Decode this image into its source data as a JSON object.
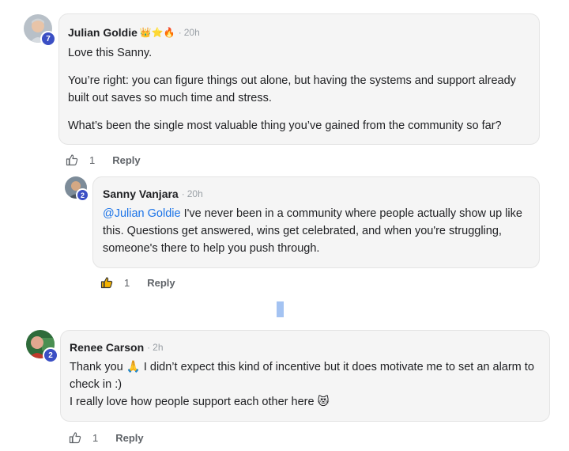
{
  "comments": [
    {
      "author": "Julian Goldie",
      "badges": "👑⭐🔥",
      "time": "20h",
      "level": "7",
      "paragraphs": [
        "Love this Sanny.",
        "You’re right: you can figure things out alone, but having the systems and support already",
        "built out saves so much time and stress.",
        "What’s been the single most valuable thing you’ve gained from the community so far?"
      ],
      "likes": "1",
      "reply_label": "Reply"
    },
    {
      "author": "Sanny Vanjara",
      "time": "20h",
      "level": "2",
      "mention": "@Julian Goldie",
      "lines": [
        "I've never been in a community where people actually show up like",
        "this. Questions get answered, wins get celebrated, and when you're struggling,",
        "someone's there to help you push through."
      ],
      "likes": "1",
      "reply_label": "Reply"
    },
    {
      "author": "Renee Carson",
      "time": "2h",
      "level": "2",
      "lines": [
        "Thank you 🙏 I didn’t expect this kind of incentive but it does motivate me to set an alarm to",
        "check in :)",
        "I really love how people support each other here 😻"
      ],
      "likes": "1",
      "reply_label": "Reply"
    }
  ],
  "separator": "·",
  "colors": {
    "mention": "#1a73e8",
    "liked": "#f5b300",
    "level_badge": "#3b4fc4"
  }
}
